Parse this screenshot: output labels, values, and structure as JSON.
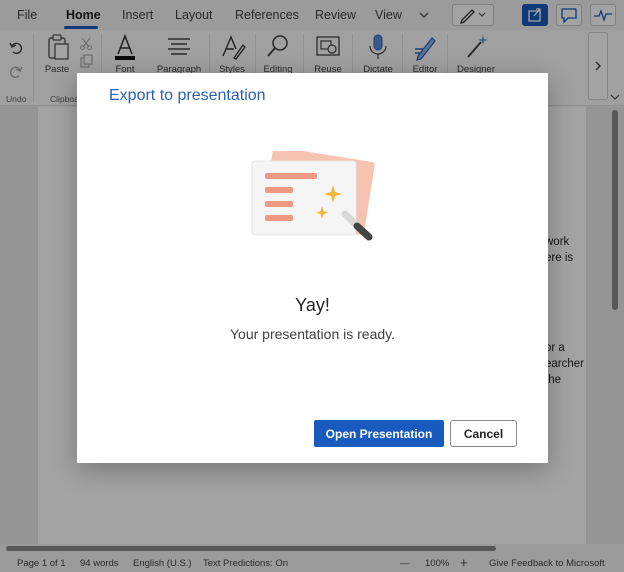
{
  "tabs": [
    "File",
    "Home",
    "Insert",
    "Layout",
    "References",
    "Review",
    "View"
  ],
  "ribbon": {
    "undo_label": "Undo",
    "clipboard_label": "Clipboa",
    "paste_label": "Paste",
    "font_label": "Font",
    "paragraph_label": "Paragraph",
    "styles_label": "Styles",
    "editing_label": "Editing",
    "reuse_label": "Reuse",
    "dictate_label": "Dictate",
    "editor_label": "Editor",
    "designer_label": "Designer"
  },
  "document": {
    "fragments": [
      "work",
      "ere is",
      "or a",
      "earcher",
      "the"
    ]
  },
  "status": {
    "page": "Page 1 of 1",
    "words": "94 words",
    "language": "English (U.S.)",
    "predictions": "Text Predictions: On",
    "minus": "—",
    "zoom": "100%",
    "plus": "+",
    "feedback": "Give Feedback to Microsoft"
  },
  "dialog": {
    "title": "Export to presentation",
    "heading": "Yay!",
    "message": "Your presentation is ready.",
    "primary_button": "Open Presentation",
    "secondary_button": "Cancel"
  },
  "colors": {
    "accent": "#185abd",
    "title_blue": "#2b62b8",
    "illustration_salmon": "#ef9a84",
    "illustration_star": "#f4b63a"
  }
}
